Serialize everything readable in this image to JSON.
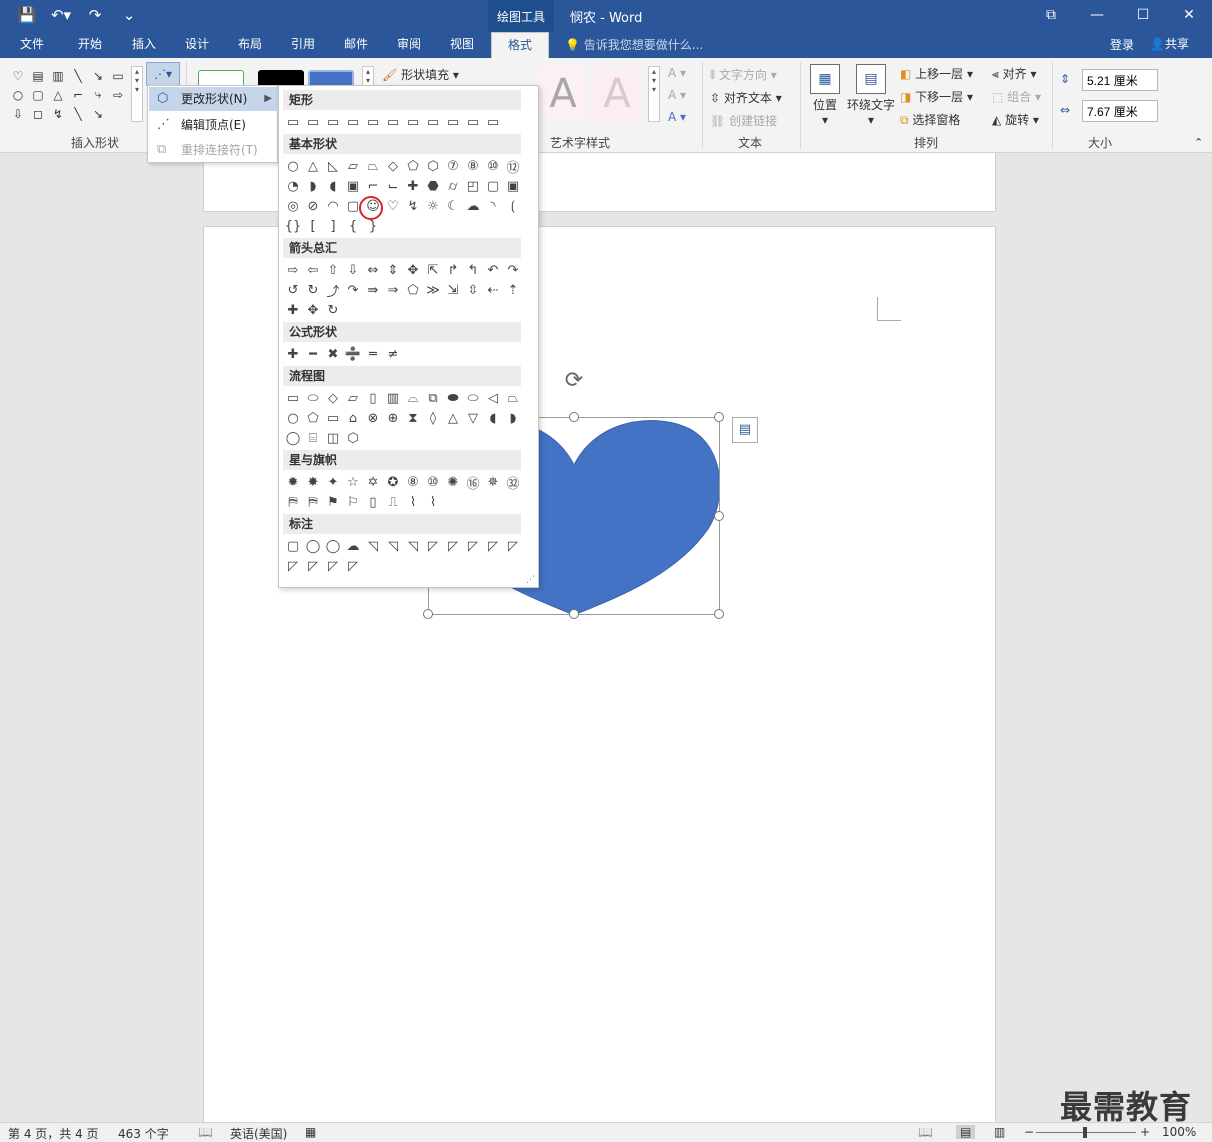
{
  "titlebar": {
    "context_label": "绘图工具",
    "doc_title": "悯农 - Word",
    "qat": [
      "save-icon",
      "undo-icon",
      "redo-icon",
      "customize-icon"
    ]
  },
  "tabs": [
    "文件",
    "开始",
    "插入",
    "设计",
    "布局",
    "引用",
    "邮件",
    "审阅",
    "视图",
    "格式"
  ],
  "active_tab": "格式",
  "tellme": "告诉我您想要做什么...",
  "login": "登录",
  "share": "共享",
  "ribbon": {
    "insert_shapes_label": "插入形状",
    "shape_fill": "形状填充",
    "wordart_label": "艺术字样式",
    "text_direction": "文字方向",
    "align_text": "对齐文本",
    "create_link": "创建链接",
    "text_label": "文本",
    "position": "位置",
    "wrap_text": "环绕文字",
    "bring_forward": "上移一层",
    "send_backward": "下移一层",
    "selection_pane": "选择窗格",
    "align": "对齐",
    "group": "组合",
    "rotate": "旋转",
    "arrange_label": "排列",
    "height": "5.21 厘米",
    "width": "7.67 厘米",
    "size_label": "大小",
    "wordart_glyph": "A"
  },
  "submenu": {
    "change_shape": "更改形状(N)",
    "edit_points": "编辑顶点(E)",
    "reroute": "重排连接符(T)"
  },
  "gallery": {
    "categories": [
      "矩形",
      "基本形状",
      "箭头总汇",
      "公式形状",
      "流程图",
      "星与旗帜",
      "标注"
    ],
    "rect_row": [
      "▭",
      "▭",
      "▭",
      "▭",
      "▭",
      "▭",
      "▭",
      "▭",
      "▭",
      "▭",
      "▭"
    ],
    "basic_rows": [
      [
        "○",
        "△",
        "◺",
        "▱",
        "⏢",
        "◇",
        "⬠",
        "⬡",
        "⑦",
        "⑧",
        "⑩",
        "⑫"
      ],
      [
        "◔",
        "◗",
        "◖",
        "▣",
        "⌐",
        "⌙",
        "✚",
        "⬣",
        "⌭",
        "◰",
        "▢",
        "▣"
      ],
      [
        "◎",
        "⊘",
        "◠",
        "▢",
        "☺",
        "♡",
        "↯",
        "☼",
        "☾",
        "☁",
        "◝",
        "⟮"
      ],
      [
        "{}",
        "[",
        "]",
        "{",
        "}"
      ]
    ],
    "arrow_rows": [
      [
        "⇨",
        "⇦",
        "⇧",
        "⇩",
        "⇔",
        "⇕",
        "✥",
        "⇱",
        "↱",
        "↰",
        "↶",
        "↷"
      ],
      [
        "↺",
        "↻",
        "⤴",
        "↷",
        "⇛",
        "⇒",
        "⬠",
        "≫",
        "⇲",
        "⇳",
        "⇠",
        "⇡"
      ],
      [
        "✚",
        "✥",
        "↻"
      ]
    ],
    "math_row": [
      "✚",
      "━",
      "✖",
      "➗",
      "═",
      "≠"
    ],
    "flow_rows": [
      [
        "▭",
        "⬭",
        "◇",
        "▱",
        "▯",
        "▥",
        "⌓",
        "⧉",
        "⬬",
        "⬭",
        "◁",
        "⏢"
      ],
      [
        "○",
        "⬠",
        "▭",
        "⌂",
        "⊗",
        "⊕",
        "⧗",
        "◊",
        "△",
        "▽",
        "◖",
        "◗"
      ],
      [
        "◯",
        "⌸",
        "◫",
        "⬡"
      ]
    ],
    "star_rows": [
      [
        "✹",
        "✸",
        "✦",
        "☆",
        "✡",
        "✪",
        "⑧",
        "⑩",
        "✺",
        "⑯",
        "✵",
        "㉜"
      ],
      [
        "⛿",
        "⛿",
        "⚑",
        "⚐",
        "▯",
        "⎍",
        "⌇",
        "⌇"
      ]
    ],
    "callout_rows": [
      [
        "▢",
        "◯",
        "◯",
        "☁",
        "◹",
        "◹",
        "◹",
        "◸",
        "◸",
        "◸",
        "◸",
        "◸"
      ],
      [
        "◸",
        "◸",
        "◸",
        "◸"
      ]
    ]
  },
  "statusbar": {
    "page": "第 4 页，共 4 页",
    "words": "463 个字",
    "language": "英语(美国)",
    "zoom": "100%"
  },
  "watermark": "最需教育",
  "colors": {
    "accent": "#2b579a",
    "heart": "#4472c4",
    "highlight_circle": "#e0202a"
  }
}
